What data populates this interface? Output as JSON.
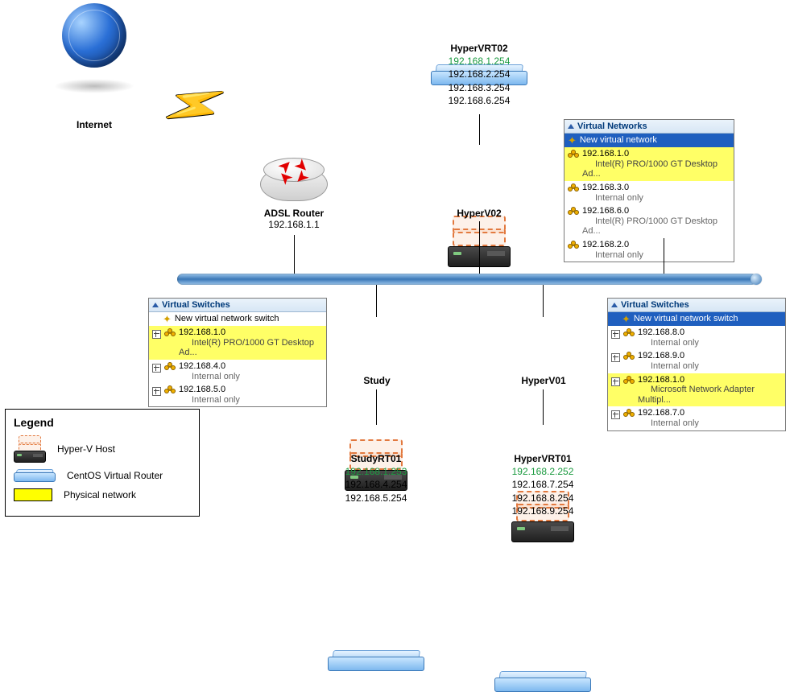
{
  "internet": {
    "label": "Internet"
  },
  "adsl": {
    "label": "ADSL Router",
    "ip": "192.168.1.1"
  },
  "hosts": {
    "hyperv02": {
      "label": "HyperV02"
    },
    "study": {
      "label": "Study"
    },
    "hyperv01": {
      "label": "HyperV01"
    }
  },
  "vrouters": {
    "hypervrt02": {
      "label": "HyperVRT02",
      "primary_ip": "192.168.1.254",
      "ips": [
        "192.168.2.254",
        "192.168.3.254",
        "192.168.6.254"
      ]
    },
    "studyrt01": {
      "label": "StudyRT01",
      "primary_ip": "192.168.1.253",
      "ips": [
        "192.168.4.254",
        "192.168.5.254"
      ]
    },
    "hypervrt01": {
      "label": "HyperVRT01",
      "primary_ip": "192.168.2.252",
      "ips": [
        "192.168.7.254",
        "192.168.8.254",
        "192.168.9.254"
      ]
    }
  },
  "panels": {
    "hyperv02_vn": {
      "title": "Virtual Networks",
      "new_label": "New virtual network",
      "items": [
        {
          "name": "192.168.1.0",
          "detail": "Intel(R) PRO/1000 GT Desktop Ad...",
          "highlight": true
        },
        {
          "name": "192.168.3.0",
          "detail": "Internal only"
        },
        {
          "name": "192.168.6.0",
          "detail": "Intel(R) PRO/1000 GT Desktop Ad..."
        },
        {
          "name": "192.168.2.0",
          "detail": "Internal only"
        }
      ]
    },
    "study_vs": {
      "title": "Virtual Switches",
      "new_label": "New virtual network switch",
      "items": [
        {
          "name": "192.168.1.0",
          "detail": "Intel(R) PRO/1000 GT Desktop Ad...",
          "highlight": true
        },
        {
          "name": "192.168.4.0",
          "detail": "Internal only"
        },
        {
          "name": "192.168.5.0",
          "detail": "Internal only"
        }
      ]
    },
    "hyperv01_vs": {
      "title": "Virtual Switches",
      "new_label": "New virtual network switch",
      "items": [
        {
          "name": "192.168.8.0",
          "detail": "Internal only"
        },
        {
          "name": "192.168.9.0",
          "detail": "Internal only"
        },
        {
          "name": "192.168.1.0",
          "detail": "Microsoft Network Adapter Multipl...",
          "highlight": true
        },
        {
          "name": "192.168.7.0",
          "detail": "Internal only"
        }
      ]
    }
  },
  "legend": {
    "title": "Legend",
    "hvhost": "Hyper-V Host",
    "vrouter": "CentOS Virtual Router",
    "physnet": "Physical network"
  }
}
